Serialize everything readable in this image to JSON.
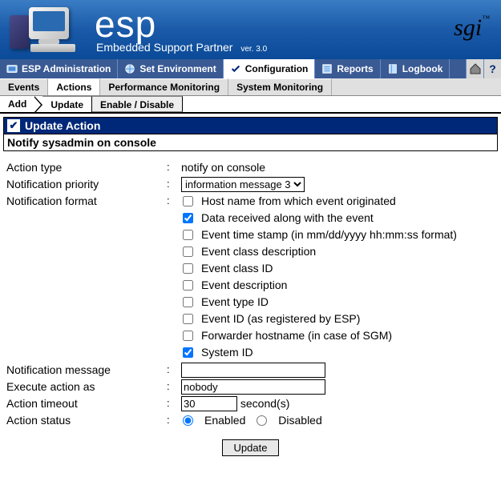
{
  "brand": {
    "name": "esp",
    "subtitle": "Embedded Support Partner",
    "version": "ver. 3.0",
    "company": "sgi"
  },
  "nav1": {
    "items": [
      {
        "label": "ESP Administration"
      },
      {
        "label": "Set Environment"
      },
      {
        "label": "Configuration",
        "active": true
      },
      {
        "label": "Reports"
      },
      {
        "label": "Logbook"
      }
    ]
  },
  "nav2": {
    "tabs": [
      {
        "label": "Events"
      },
      {
        "label": "Actions",
        "active": true
      },
      {
        "label": "Performance Monitoring"
      },
      {
        "label": "System Monitoring"
      }
    ]
  },
  "nav3": {
    "crumbs": [
      {
        "label": "Add"
      },
      {
        "label": "Update",
        "active": true
      },
      {
        "label": "Enable / Disable"
      }
    ]
  },
  "panel": {
    "title": "Update Action",
    "subtitle": "Notify sysadmin on console"
  },
  "form": {
    "action_type": {
      "label": "Action type",
      "value": "notify on console"
    },
    "priority": {
      "label": "Notification priority",
      "value": "information message 3"
    },
    "format": {
      "label": "Notification format",
      "options": [
        {
          "label": "Host name from which event originated",
          "checked": false
        },
        {
          "label": "Data received along with the event",
          "checked": true
        },
        {
          "label": "Event time stamp (in mm/dd/yyyy hh:mm:ss format)",
          "checked": false
        },
        {
          "label": "Event class description",
          "checked": false
        },
        {
          "label": "Event class ID",
          "checked": false
        },
        {
          "label": "Event description",
          "checked": false
        },
        {
          "label": "Event type ID",
          "checked": false
        },
        {
          "label": "Event ID (as registered by ESP)",
          "checked": false
        },
        {
          "label": "Forwarder hostname (in case of SGM)",
          "checked": false
        },
        {
          "label": "System ID",
          "checked": true
        }
      ]
    },
    "message": {
      "label": "Notification message",
      "value": ""
    },
    "execute_as": {
      "label": "Execute action as",
      "value": "nobody"
    },
    "timeout": {
      "label": "Action timeout",
      "value": "30",
      "unit": "second(s)"
    },
    "status": {
      "label": "Action status",
      "enabled_label": "Enabled",
      "disabled_label": "Disabled",
      "value": "enabled"
    },
    "submit": "Update"
  }
}
